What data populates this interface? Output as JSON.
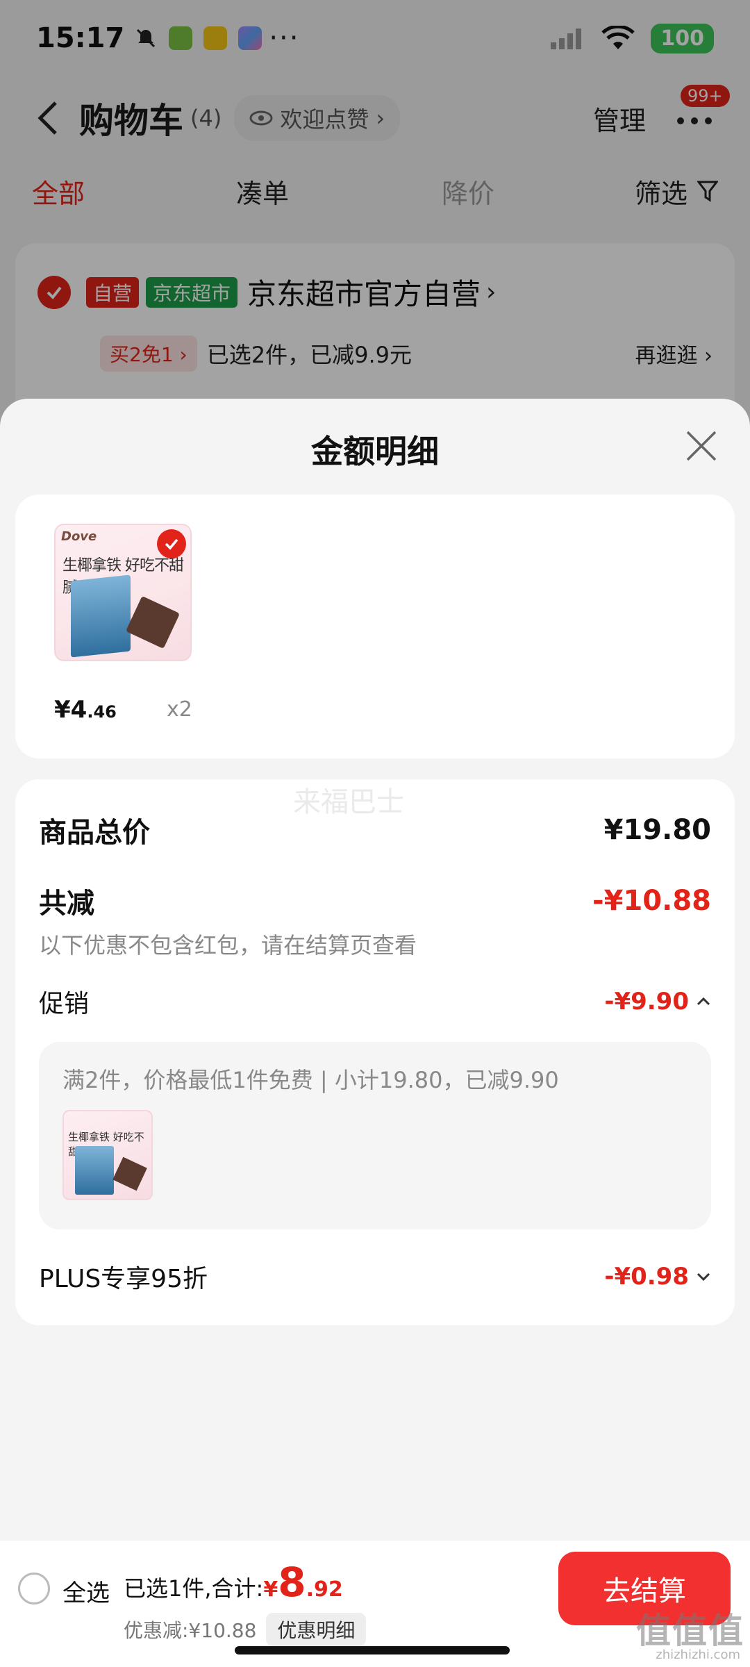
{
  "status_bar": {
    "time": "15:17",
    "more": "···",
    "battery": "100"
  },
  "header": {
    "title": "购物车",
    "count": "(4)",
    "like_label": "欢迎点赞",
    "like_chevron": "›",
    "manage_label": "管理",
    "badge": "99+"
  },
  "tabs": {
    "all": "全部",
    "bundle": "凑单",
    "price_drop": "降价",
    "filter": "筛选"
  },
  "store": {
    "tag_self": "自营",
    "tag_jd": "京东超市",
    "name": "京东超市官方自营",
    "name_chevron": "›",
    "promo_tag": "买2免1 ›",
    "promo_text": "已选2件，已减9.9元",
    "shop_more": "再逛逛 ›"
  },
  "sheet": {
    "title": "金额明细",
    "product": {
      "img_brand": "Dove",
      "img_text": "生椰拿铁 好吃不甜腻",
      "price_yen": "¥4",
      "price_cents": ".46",
      "qty": "x2"
    },
    "watermark": "来福巴士",
    "total_label": "商品总价",
    "total_value": "¥19.80",
    "reduce_label": "共减",
    "reduce_value": "-¥10.88",
    "reduce_note": "以下优惠不包含红包，请在结算页查看",
    "promo_label": "促销",
    "promo_value": "-¥9.90",
    "promo_box_text": "满2件，价格最低1件免费 | 小计19.80，已减9.90",
    "promo_thumb_text": "生椰拿铁 好吃不甜腻",
    "plus_label": "PLUS专享95折",
    "plus_value": "-¥0.98"
  },
  "bottom_bar": {
    "select_all": "全选",
    "selected_prefix": "已选1件,合计:",
    "total_yen": "¥",
    "total_int": "8",
    "total_dec": ".92",
    "discount_text": "优惠减:¥10.88",
    "discount_detail": "优惠明细",
    "checkout": "去结算"
  },
  "corner_watermark": {
    "logo": "值值值",
    "site": "zhizhizhi.com"
  },
  "colors": {
    "accent_red": "#e2231a",
    "checkout_red": "#f23030",
    "jd_green": "#1f9e4a",
    "battery_green": "#3ec55a"
  }
}
